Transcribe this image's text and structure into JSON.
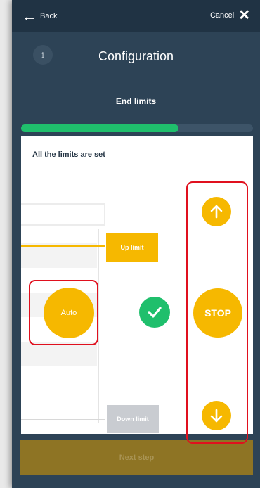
{
  "header": {
    "back_label": "Back",
    "cancel_label": "Cancel"
  },
  "page": {
    "title": "Configuration",
    "subtitle": "End limits",
    "info_glyph": "i"
  },
  "progress": {
    "fraction": 0.68,
    "color": "#1fbf6c"
  },
  "card": {
    "status_text": "All the limits are set"
  },
  "window": {
    "up_limit_label": "Up limit",
    "down_limit_label": "Down limit",
    "auto_label": "Auto"
  },
  "controls": {
    "stop_label": "STOP",
    "up_icon": "arrow-up-icon",
    "down_icon": "arrow-down-icon"
  },
  "footer": {
    "next_label": "Next step"
  },
  "colors": {
    "accent": "#f6b800",
    "success": "#1fbf6c",
    "background": "#2d4356",
    "topbar": "#203344",
    "highlight": "#e0101e",
    "next_button": "#8e7424"
  }
}
